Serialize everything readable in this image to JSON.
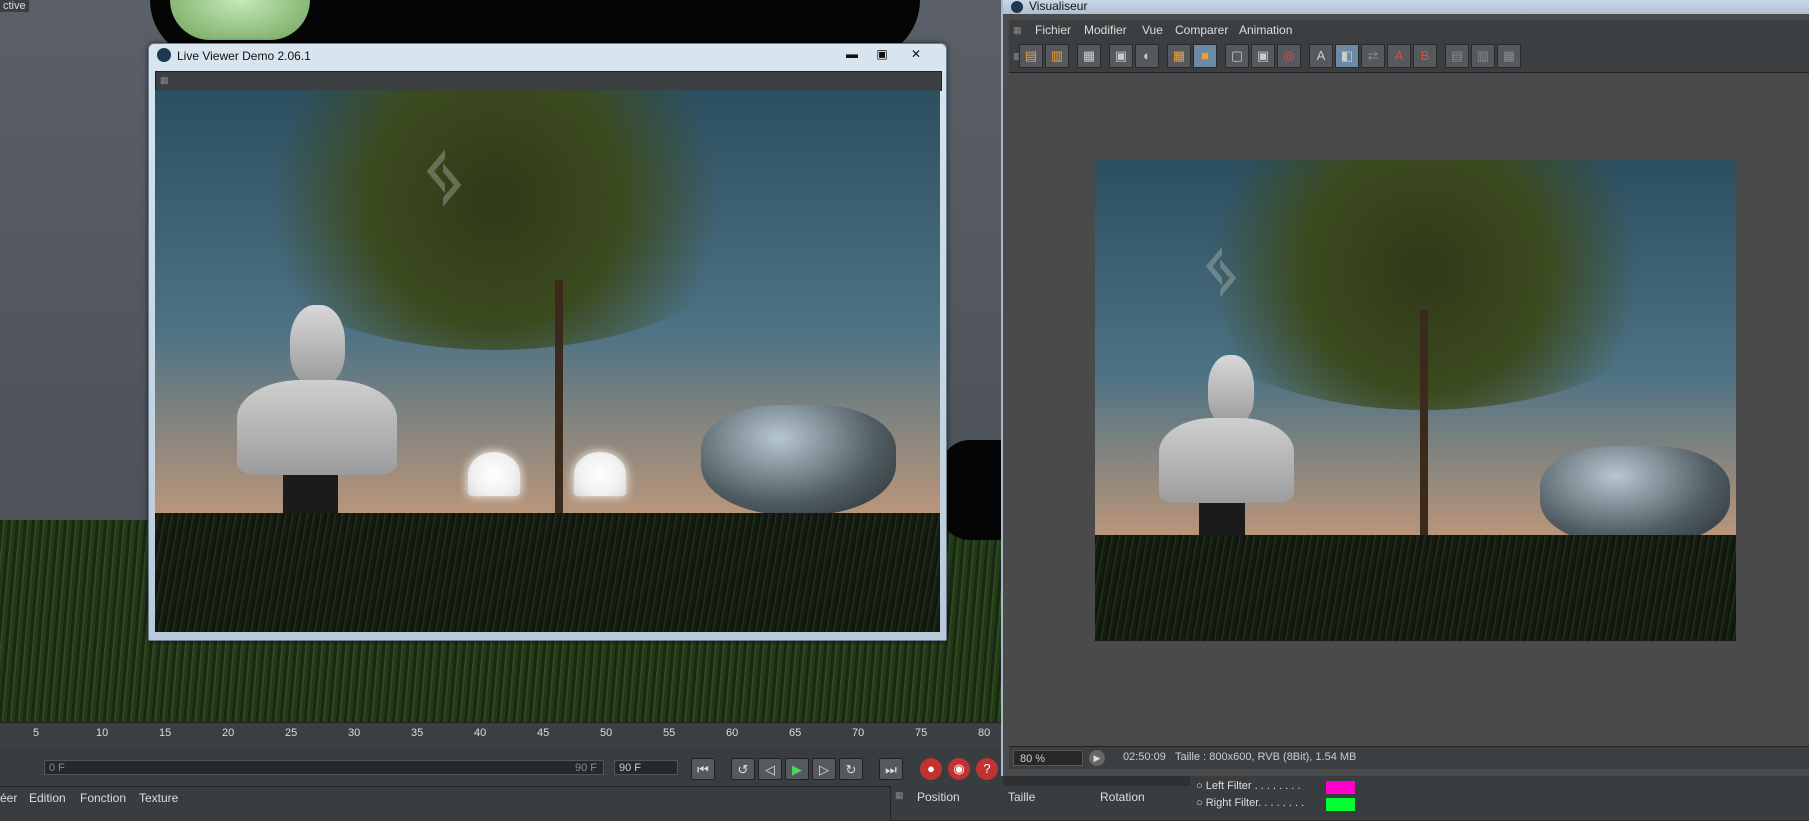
{
  "background_app": {
    "tab_label": "ctive",
    "timeline_ticks": [
      "5",
      "10",
      "15",
      "20",
      "25",
      "30",
      "35",
      "40",
      "45",
      "50",
      "55",
      "60",
      "65",
      "70",
      "75",
      "80"
    ],
    "start_frame": "0 F",
    "end_frame_slider": "90 F",
    "end_frame_field": "90 F",
    "material_menu": [
      "éer",
      "Edition",
      "Fonction",
      "Texture"
    ],
    "coord_headers": [
      "Position",
      "Taille",
      "Rotation"
    ],
    "filters": [
      {
        "label": "Left Filter . . . . . . . .",
        "color": "#ff00cc"
      },
      {
        "label": "Right Filter. . . . . . . .",
        "color": "#00ff33"
      }
    ]
  },
  "live_viewer": {
    "title": "Live Viewer Demo 2.06.1",
    "min_glyph": "▬",
    "max_glyph": "▣",
    "close_glyph": "✕"
  },
  "visualiseur": {
    "title": "Visualiseur",
    "menu": [
      "Fichier",
      "Modifier",
      "Vue",
      "Comparer",
      "Animation"
    ],
    "status": {
      "zoom": "80 %",
      "time": "02:50:09",
      "info": "Taille : 800x600, RVB (8Bit), 1.54 MB"
    }
  }
}
